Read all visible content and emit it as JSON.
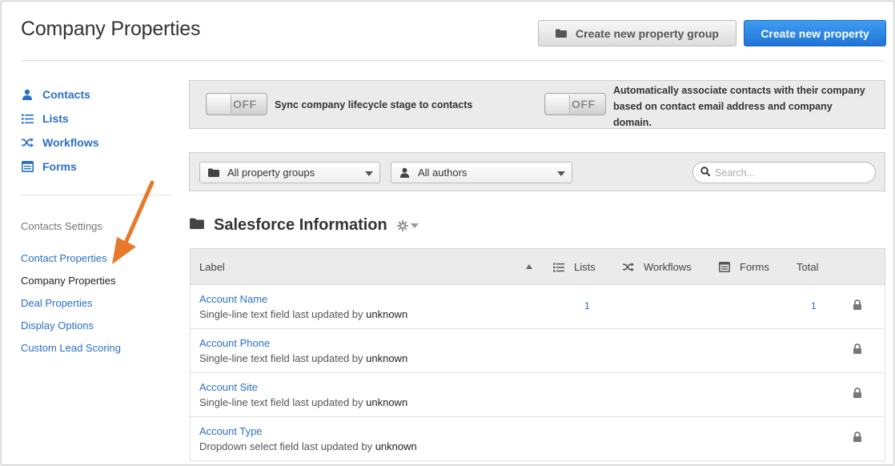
{
  "header": {
    "title": "Company Properties",
    "create_group_label": "Create new property group",
    "create_property_label": "Create new property"
  },
  "sidebar": {
    "nav": [
      {
        "label": "Contacts",
        "icon": "person-icon"
      },
      {
        "label": "Lists",
        "icon": "list-icon"
      },
      {
        "label": "Workflows",
        "icon": "shuffle-icon"
      },
      {
        "label": "Forms",
        "icon": "form-icon"
      }
    ],
    "settings_heading": "Contacts Settings",
    "settings_links": [
      {
        "label": "Contact Properties",
        "active": false
      },
      {
        "label": "Company Properties",
        "active": true
      },
      {
        "label": "Deal Properties",
        "active": false
      },
      {
        "label": "Display Options",
        "active": false
      },
      {
        "label": "Custom Lead Scoring",
        "active": false
      }
    ]
  },
  "sync": {
    "toggle_text": "OFF",
    "lifecycle_label": "Sync company lifecycle stage to contacts",
    "associate_label_1": "Automatically associate contacts with their company",
    "associate_label_2": "based on contact email address and company",
    "associate_label_3": "domain."
  },
  "filters": {
    "groups_selected": "All property groups",
    "authors_selected": "All authors",
    "search_placeholder": "Search..."
  },
  "group": {
    "title": "Salesforce Information"
  },
  "table": {
    "headers": {
      "label": "Label",
      "lists": "Lists",
      "workflows": "Workflows",
      "forms": "Forms",
      "total": "Total"
    },
    "rows": [
      {
        "name": "Account Name",
        "desc": "Single-line text field last updated by",
        "who": "unknown",
        "lists": "1",
        "total": "1"
      },
      {
        "name": "Account Phone",
        "desc": "Single-line text field last updated by",
        "who": "unknown",
        "lists": "",
        "total": ""
      },
      {
        "name": "Account Site",
        "desc": "Single-line text field last updated by",
        "who": "unknown",
        "lists": "",
        "total": ""
      },
      {
        "name": "Account Type",
        "desc": "Dropdown select field last updated by",
        "who": "unknown",
        "lists": "",
        "total": ""
      }
    ]
  },
  "colors": {
    "link": "#2a70c7",
    "primary_button": "#2a83e4",
    "annotation_arrow": "#e8782a"
  }
}
